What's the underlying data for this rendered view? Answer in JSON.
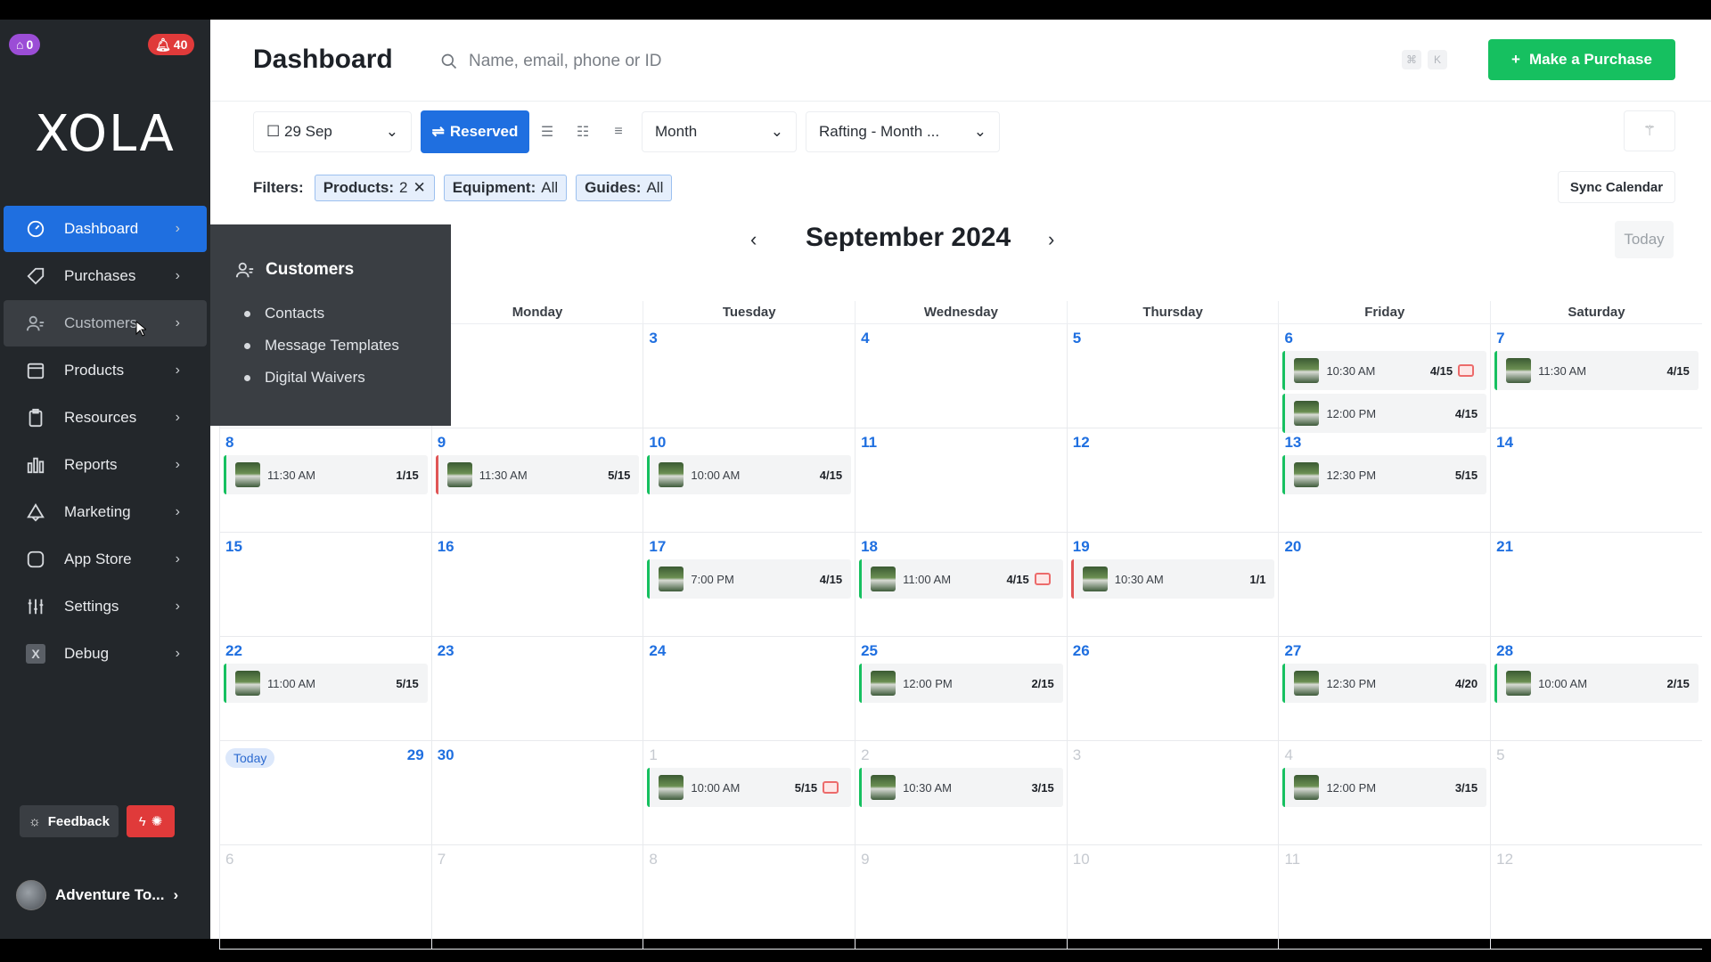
{
  "badges": {
    "notifications_a": "0",
    "alerts": "40"
  },
  "logo": "XOLA",
  "sidebar": {
    "items": [
      {
        "label": "Dashboard",
        "icon": "dashboard-icon"
      },
      {
        "label": "Purchases",
        "icon": "tag-icon"
      },
      {
        "label": "Customers",
        "icon": "users-icon"
      },
      {
        "label": "Products",
        "icon": "box-icon"
      },
      {
        "label": "Resources",
        "icon": "clipboard-icon"
      },
      {
        "label": "Reports",
        "icon": "bar-chart-icon"
      },
      {
        "label": "Marketing",
        "icon": "megaphone-icon"
      },
      {
        "label": "App Store",
        "icon": "app-icon"
      },
      {
        "label": "Settings",
        "icon": "sliders-icon"
      },
      {
        "label": "Debug",
        "icon": "debug-icon"
      }
    ],
    "feedback_label": "Feedback",
    "account_name": "Adventure To..."
  },
  "popover": {
    "title": "Customers",
    "items": [
      "Contacts",
      "Message Templates",
      "Digital Waivers"
    ]
  },
  "header": {
    "title": "Dashboard",
    "search_placeholder": "Name, email, phone or ID",
    "kbd_1": "⌘",
    "kbd_2": "K",
    "purchase_button": "Make a Purchase"
  },
  "toolbar": {
    "date": "29 Sep",
    "reserved": "Reserved",
    "view": "Month",
    "product_filter": "Rafting - Month ..."
  },
  "filters": {
    "label": "Filters:",
    "products_key": "Products:",
    "products_val": "2",
    "equipment_key": "Equipment:",
    "equipment_val": "All",
    "guides_key": "Guides:",
    "guides_val": "All",
    "sync": "Sync Calendar"
  },
  "calendar": {
    "title": "September 2024",
    "today": "Today",
    "today_badge": "Today",
    "weekdays": [
      "",
      "Monday",
      "Tuesday",
      "Wednesday",
      "Thursday",
      "Friday",
      "Saturday"
    ],
    "weeks": [
      {
        "days": [
          {
            "n": "",
            "events": []
          },
          {
            "n": "",
            "events": []
          },
          {
            "n": "3",
            "events": []
          },
          {
            "n": "4",
            "events": []
          },
          {
            "n": "5",
            "events": []
          },
          {
            "n": "6",
            "events": [
              {
                "t": "10:30 AM",
                "c": "4/15",
                "note": true,
                "red": false
              },
              {
                "t": "12:00 PM",
                "c": "4/15",
                "note": false,
                "red": false
              }
            ]
          },
          {
            "n": "7",
            "events": [
              {
                "t": "11:30 AM",
                "c": "4/15",
                "note": false,
                "red": false
              }
            ]
          }
        ]
      },
      {
        "days": [
          {
            "n": "8",
            "events": [
              {
                "t": "11:30 AM",
                "c": "1/15",
                "note": false,
                "red": false
              }
            ]
          },
          {
            "n": "9",
            "events": [
              {
                "t": "11:30 AM",
                "c": "5/15",
                "note": false,
                "red": true
              }
            ]
          },
          {
            "n": "10",
            "events": [
              {
                "t": "10:00 AM",
                "c": "4/15",
                "note": false,
                "red": false
              }
            ]
          },
          {
            "n": "11",
            "events": []
          },
          {
            "n": "12",
            "events": []
          },
          {
            "n": "13",
            "events": [
              {
                "t": "12:30 PM",
                "c": "5/15",
                "note": false,
                "red": false
              }
            ]
          },
          {
            "n": "14",
            "events": []
          }
        ]
      },
      {
        "days": [
          {
            "n": "15",
            "events": []
          },
          {
            "n": "16",
            "events": []
          },
          {
            "n": "17",
            "events": [
              {
                "t": "7:00 PM",
                "c": "4/15",
                "note": false,
                "red": false
              }
            ]
          },
          {
            "n": "18",
            "events": [
              {
                "t": "11:00 AM",
                "c": "4/15",
                "note": true,
                "red": false
              }
            ]
          },
          {
            "n": "19",
            "events": [
              {
                "t": "10:30 AM",
                "c": "1/1",
                "note": false,
                "red": true
              }
            ]
          },
          {
            "n": "20",
            "events": []
          },
          {
            "n": "21",
            "events": []
          }
        ]
      },
      {
        "days": [
          {
            "n": "22",
            "events": [
              {
                "t": "11:00 AM",
                "c": "5/15",
                "note": false,
                "red": false
              }
            ]
          },
          {
            "n": "23",
            "events": []
          },
          {
            "n": "24",
            "events": []
          },
          {
            "n": "25",
            "events": [
              {
                "t": "12:00 PM",
                "c": "2/15",
                "note": false,
                "red": false
              }
            ]
          },
          {
            "n": "26",
            "events": []
          },
          {
            "n": "27",
            "events": [
              {
                "t": "12:30 PM",
                "c": "4/20",
                "note": false,
                "red": false
              }
            ]
          },
          {
            "n": "28",
            "events": [
              {
                "t": "10:00 AM",
                "c": "2/15",
                "note": false,
                "red": false
              }
            ]
          }
        ]
      },
      {
        "days": [
          {
            "n": "29",
            "today": true,
            "events": []
          },
          {
            "n": "30",
            "events": []
          },
          {
            "n": "1",
            "other": true,
            "events": [
              {
                "t": "10:00 AM",
                "c": "5/15",
                "note": true,
                "red": false
              }
            ]
          },
          {
            "n": "2",
            "other": true,
            "events": [
              {
                "t": "10:30 AM",
                "c": "3/15",
                "note": false,
                "red": false
              }
            ]
          },
          {
            "n": "3",
            "other": true,
            "events": []
          },
          {
            "n": "4",
            "other": true,
            "events": [
              {
                "t": "12:00 PM",
                "c": "3/15",
                "note": false,
                "red": false
              }
            ]
          },
          {
            "n": "5",
            "other": true,
            "events": []
          }
        ]
      },
      {
        "days": [
          {
            "n": "6",
            "other": true,
            "events": []
          },
          {
            "n": "7",
            "other": true,
            "events": []
          },
          {
            "n": "8",
            "other": true,
            "events": []
          },
          {
            "n": "9",
            "other": true,
            "events": []
          },
          {
            "n": "10",
            "other": true,
            "events": []
          },
          {
            "n": "11",
            "other": true,
            "events": []
          },
          {
            "n": "12",
            "other": true,
            "events": []
          }
        ]
      }
    ]
  },
  "colors": {
    "primary": "#1f6fe0",
    "success": "#16c060",
    "danger": "#e03a3a",
    "sidebar": "#23272b"
  }
}
